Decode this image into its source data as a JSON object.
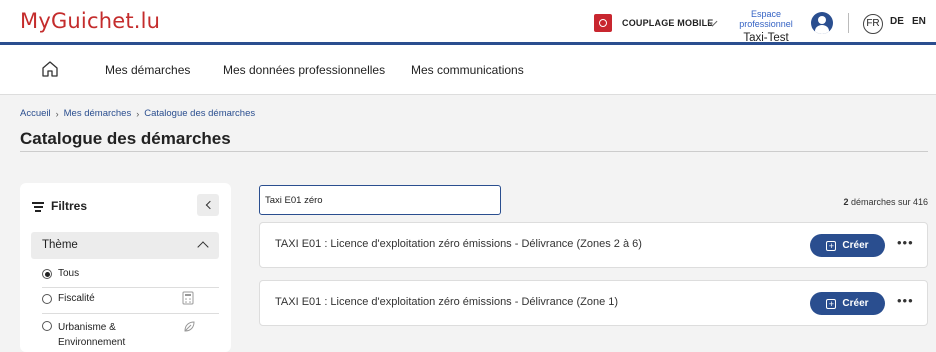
{
  "header": {
    "logo": "MyGuichet.lu",
    "couplage_label": "COUPLAGE MOBILE",
    "space_small": "Espace professionnel",
    "space_name": "Taxi-Test",
    "langs": [
      "FR",
      "DE",
      "EN"
    ],
    "accent": "#2a4e8f",
    "brand": "#c42c2c"
  },
  "nav": {
    "home_icon": "home-icon",
    "items": [
      "Mes démarches",
      "Mes données professionnelles",
      "Mes communications"
    ]
  },
  "breadcrumb": [
    "Accueil",
    "Mes démarches",
    "Catalogue des démarches"
  ],
  "page_title": "Catalogue des démarches",
  "filters": {
    "title": "Filtres",
    "theme_label": "Thème",
    "options": [
      {
        "label": "Tous",
        "selected": true
      },
      {
        "label": "Fiscalité",
        "selected": false,
        "icon": "calculator-icon"
      },
      {
        "label": "Urbanisme &",
        "label2": "Environnement",
        "selected": false,
        "icon": "leaf-icon"
      }
    ]
  },
  "search": {
    "value": "Taxi E01 zéro"
  },
  "results": {
    "count": "2",
    "count_suffix": " démarches sur 416",
    "items": [
      {
        "title": "TAXI E01 : Licence d'exploitation zéro émissions - Délivrance (Zones 2 à 6)",
        "action": "Créer"
      },
      {
        "title": "TAXI E01 : Licence d'exploitation zéro émissions - Délivrance (Zone 1)",
        "action": "Créer"
      }
    ]
  }
}
